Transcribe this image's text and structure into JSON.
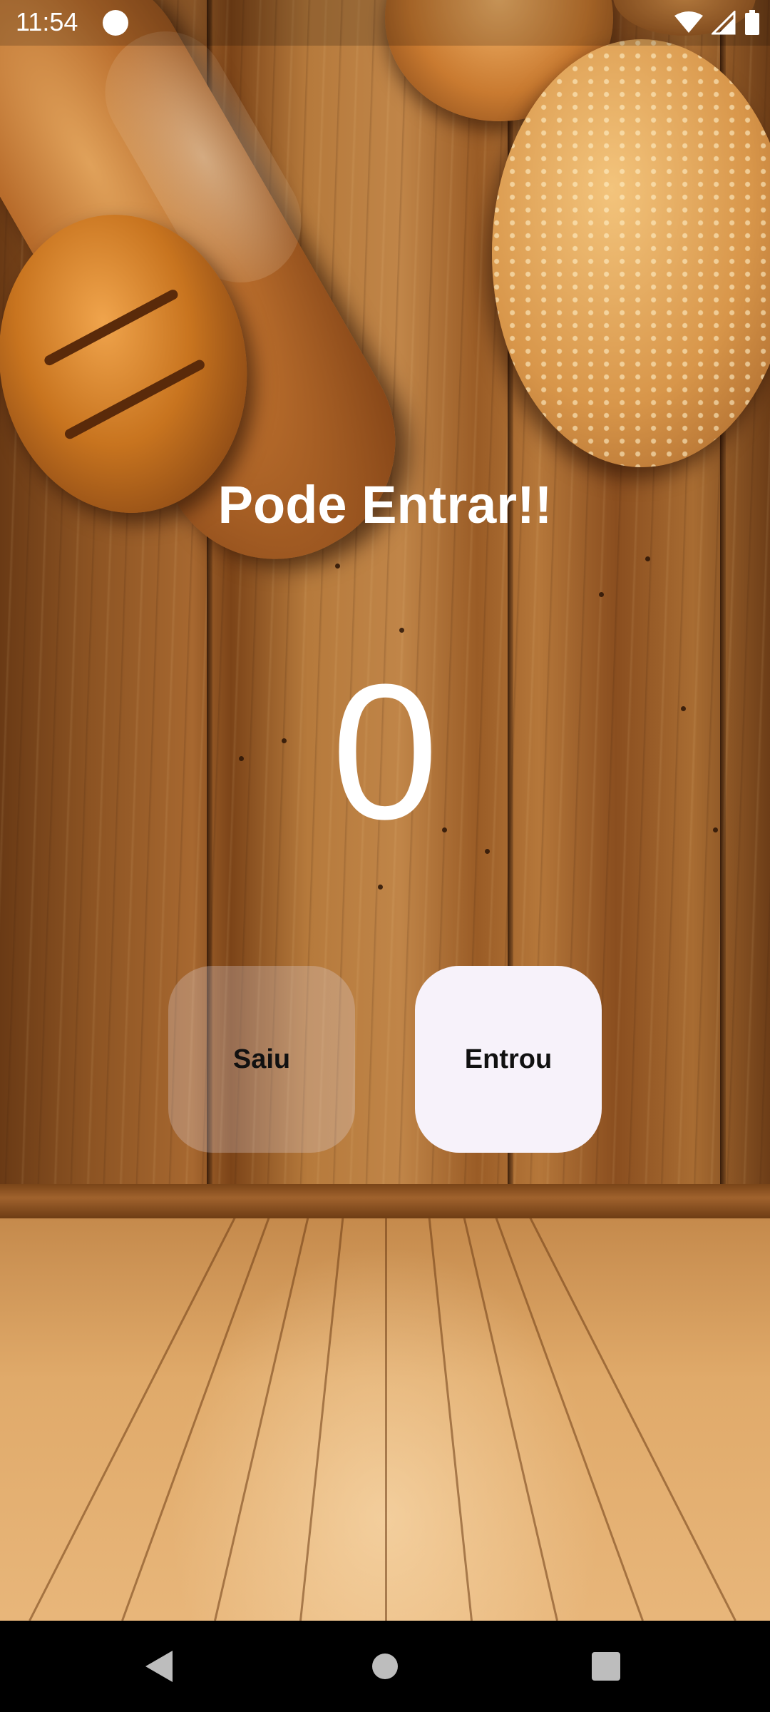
{
  "status_bar": {
    "time": "11:54",
    "icons": [
      "app-notification-icon",
      "wifi-icon",
      "cell-signal-icon",
      "battery-icon"
    ]
  },
  "main": {
    "title": "Pode Entrar!!",
    "counter": "0",
    "buttons": {
      "saiu_label": "Saiu",
      "entrou_label": "Entrou"
    }
  },
  "nav_bar": {
    "icons": [
      "back-icon",
      "home-icon",
      "recents-icon"
    ]
  },
  "colors": {
    "title_text": "#ffffff",
    "button_primary_bg": "#f7f2fa",
    "button_text": "#111111",
    "nav_bar_bg": "#000000"
  }
}
